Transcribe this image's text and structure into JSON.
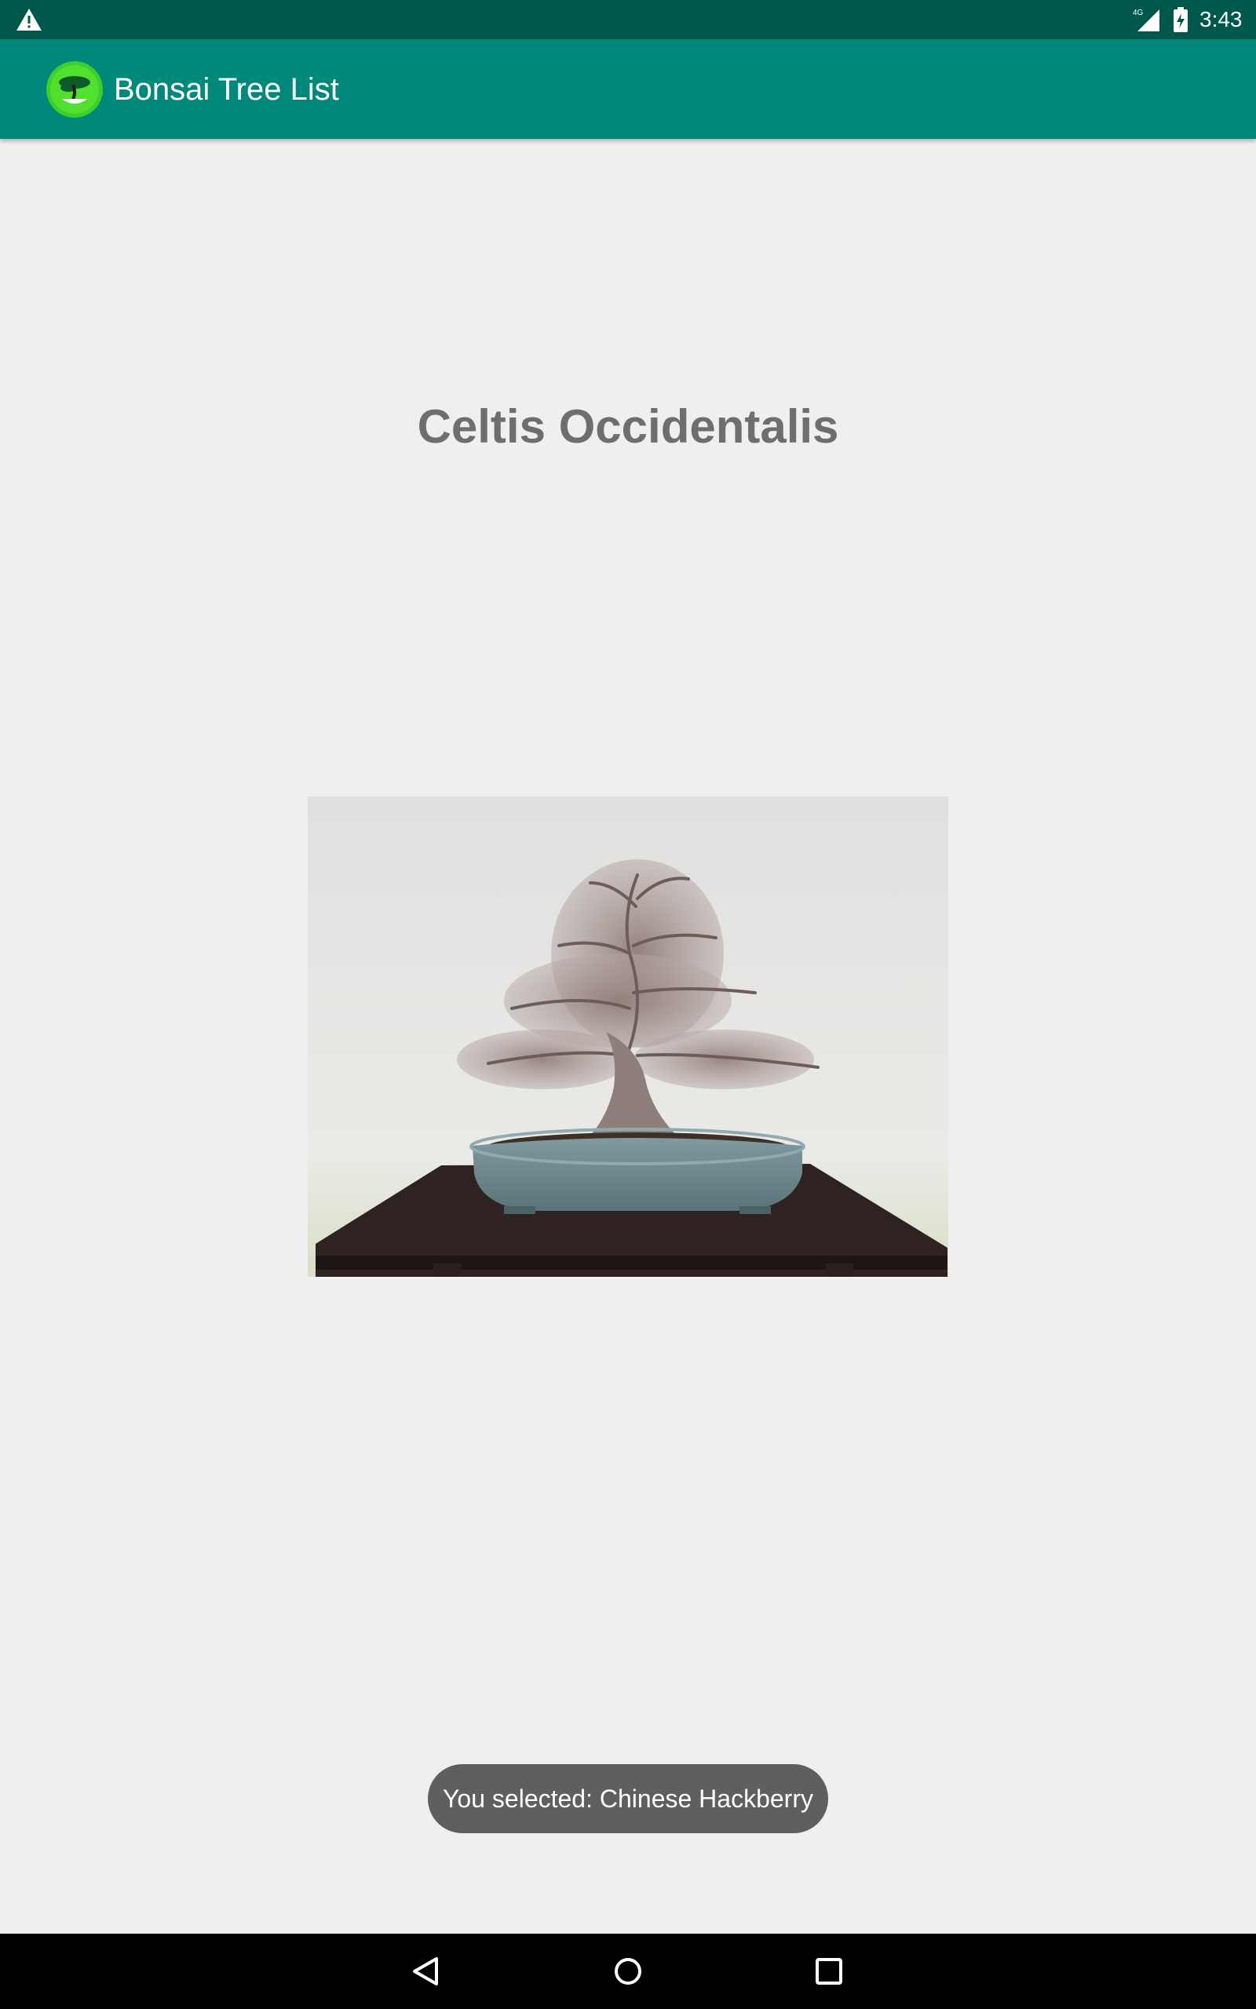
{
  "status_bar": {
    "time": "3:43",
    "network": "4G",
    "icons": [
      "warning-icon",
      "signal-icon",
      "battery-charging-icon"
    ]
  },
  "app_bar": {
    "title": "Bonsai Tree List",
    "icon": "bonsai-logo-icon"
  },
  "detail": {
    "tree_name": "Celtis Occidentalis",
    "image": "bonsai-tree-photo"
  },
  "toast": {
    "message": "You selected: Chinese Hackberry"
  },
  "nav_bar": {
    "icons": [
      "back-icon",
      "home-icon",
      "recents-icon"
    ]
  },
  "colors": {
    "status_bar": "#00574b",
    "app_bar": "#00897b",
    "background": "#efefef",
    "title_text": "#6e6e6e",
    "toast": "#5f5f5f"
  }
}
